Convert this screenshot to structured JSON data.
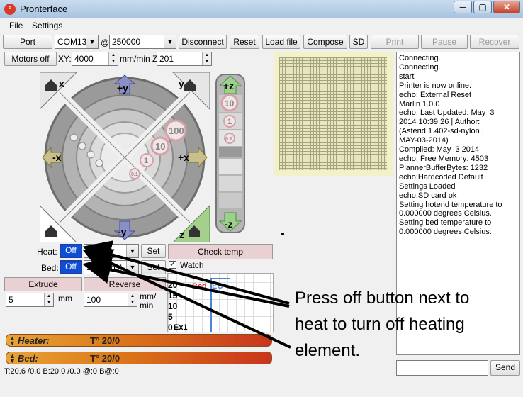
{
  "window": {
    "title": "Pronterface",
    "logo_text": "ᴾ",
    "min": "─",
    "max": "▢",
    "close": "✕"
  },
  "menu": {
    "file": "File",
    "settings": "Settings"
  },
  "toolbar": {
    "port_label": "Port",
    "port_value": "COM13",
    "at": "@",
    "baud_value": "250000",
    "disconnect": "Disconnect",
    "reset": "Reset",
    "load_file": "Load file",
    "compose": "Compose",
    "sd": "SD",
    "print": "Print",
    "pause": "Pause",
    "recover": "Recover"
  },
  "motion": {
    "motors_off": "Motors off",
    "xy_label": "XY:",
    "xy_value": "4000",
    "unit_label": "mm/min Z:",
    "z_value": "201"
  },
  "jog": {
    "home_x": "x",
    "home_y": "y",
    "home_z": "z",
    "plus_y": "+y",
    "minus_y": "-y",
    "minus_x": "-x",
    "plus_x": "+x",
    "steps": [
      "100",
      "10",
      "1",
      "0.1"
    ],
    "plus_z": "+z",
    "minus_z": "-z",
    "z_steps": [
      "10",
      "1",
      "0.1"
    ]
  },
  "temp": {
    "heat_label": "Heat:",
    "heat_off": "Off",
    "heat_value": "5 (abs)",
    "heat_set": "Set",
    "check_temp": "Check temp",
    "bed_label": "Bed:",
    "bed_off": "Off",
    "bed_value": "120 (abs)",
    "bed_set": "Set",
    "watch_label": "Watch",
    "watch_checked": true
  },
  "extrude": {
    "extrude": "Extrude",
    "reverse": "Reverse",
    "length_value": "5",
    "length_unit": "mm",
    "speed_value": "100",
    "speed_unit_1": "mm/",
    "speed_unit_2": "min"
  },
  "graph": {
    "labels": [
      "20",
      "15",
      "10",
      "5",
      "0"
    ],
    "bed_tag": "Bed",
    "ex_tag": "Ex1",
    "extra": "EO"
  },
  "gauges": {
    "heater_label": "Heater:",
    "heater_value": "T° 20/0",
    "bed_label": "Bed:",
    "bed_value": "T° 20/0"
  },
  "status": {
    "text": "T:20.6 /0.0 B:20.0 /0.0 @:0 B@:0"
  },
  "log": {
    "lines": [
      "Connecting...",
      "Connecting...",
      "start",
      "Printer is now online.",
      "echo: External Reset",
      "Marlin 1.0.0",
      "echo: Last Updated: May  3",
      "2014 10:39:26 | Author:",
      "(Asterid 1.402-sd-nylon ,",
      "MAY-03-2014)",
      "Compiled: May  3 2014",
      "echo: Free Memory: 4503",
      "PlannerBufferBytes: 1232",
      "echo:Hardcoded Default",
      "Settings Loaded",
      "echo:SD card ok",
      "Setting hotend temperature to",
      "0.000000 degrees Celsius.",
      "Setting bed temperature to",
      "0.000000 degrees Celsius."
    ],
    "send": "Send"
  },
  "annotation": {
    "lines": [
      "Press off button next to",
      "heat to turn off heating",
      "element."
    ]
  }
}
